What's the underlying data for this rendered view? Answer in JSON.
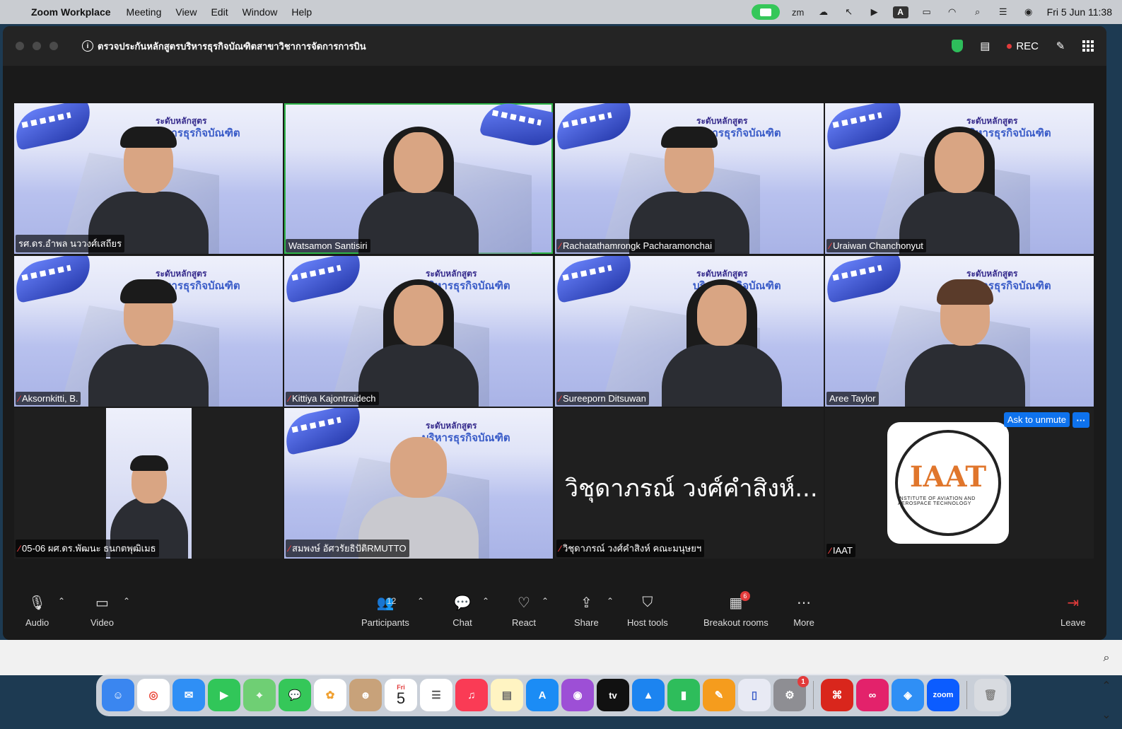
{
  "menubar": {
    "app_name": "Zoom Workplace",
    "items": [
      "Meeting",
      "View",
      "Edit",
      "Window",
      "Help"
    ],
    "clock": "Fri 5 Jun  11:38",
    "input_source": "A"
  },
  "window": {
    "meeting_title": "ตรวจประกันหลักสูตรบริหารธุรกิจบัณฑิตสาขาวิชาการจัดการการบิน",
    "rec_label": "REC"
  },
  "background_text": {
    "line1": "ระดับหลักสูตร",
    "line2": "บริหารธุรกิจบัณฑิต"
  },
  "participants": [
    {
      "name": "รศ.ดร.อำพล นววงศ์เสถียร",
      "muted": false
    },
    {
      "name": "Watsamon Santisiri",
      "muted": false,
      "active_speaker": true
    },
    {
      "name": "Rachatathamrongk Pacharamonchai",
      "muted": true
    },
    {
      "name": "Uraiwan Chanchonyut",
      "muted": true
    },
    {
      "name": "Aksornkitti, B.",
      "muted": true
    },
    {
      "name": "Kittiya Kajontraidech",
      "muted": true
    },
    {
      "name": "Sureeporn Ditsuwan",
      "muted": true
    },
    {
      "name": "Aree Taylor",
      "muted": false
    },
    {
      "name": "05-06 ผศ.ดร.พัฒนะ ธนกตพุฒิเมธ",
      "muted": true
    },
    {
      "name": "สมพงษ์ อัศวรัยธิปัติRMUTTO",
      "muted": true
    },
    {
      "name": "วิชุดาภรณ์ วงศ์คำสิงห์ คณะมนุษยฯ",
      "muted": true,
      "display_name": "วิชุดาภรณ์ วงศ์คำสิงห์..."
    },
    {
      "name": "IAAT",
      "muted": true,
      "logo_text": "IAAT",
      "logo_ring_text": "INSTITUTE OF AVIATION AND AEROSPACE TECHNOLOGY"
    }
  ],
  "ask_to_unmute": "Ask to unmute",
  "toolbar": {
    "audio": "Audio",
    "video": "Video",
    "participants": "Participants",
    "participants_count": "12",
    "chat": "Chat",
    "react": "React",
    "share": "Share",
    "host_tools": "Host tools",
    "breakout_rooms": "Breakout rooms",
    "breakout_badge": "6",
    "more": "More",
    "leave": "Leave"
  },
  "dock": {
    "calendar_month": "Fri",
    "calendar_day": "5",
    "settings_badge": "1",
    "apps": [
      "finder",
      "chrome",
      "mail",
      "facetime",
      "maps",
      "messages",
      "photos",
      "contacts",
      "calendar",
      "reminders",
      "music",
      "notes",
      "app-store",
      "podcasts",
      "tv",
      "keynote",
      "numbers",
      "pages",
      "simulator",
      "system-settings",
      "acrobat",
      "creative-cloud",
      "safari",
      "zoom",
      "trash"
    ],
    "tv_label": "tv",
    "zoom_label": "zoom"
  },
  "colors": {
    "active_speaker": "#2fb54a",
    "muted": "#e23b3b",
    "accent": "#0e72ed",
    "rec": "#e23b3b"
  }
}
